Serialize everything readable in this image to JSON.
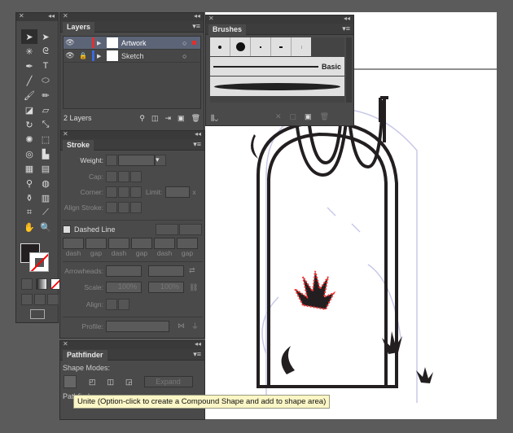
{
  "layers": {
    "tab": "Layers",
    "items": [
      {
        "name": "Artwork",
        "color": "#e03030",
        "selected": true
      },
      {
        "name": "Sketch",
        "color": "#3a6ae0",
        "locked": true
      }
    ],
    "count": "2 Layers"
  },
  "brushes": {
    "tab": "Brushes",
    "basic_label": "Basic"
  },
  "stroke": {
    "tab": "Stroke",
    "weight": "Weight:",
    "cap": "Cap:",
    "corner": "Corner:",
    "limit": "Limit:",
    "limit_unit": "x",
    "align_stroke": "Align Stroke:",
    "dashed_line": "Dashed Line",
    "dash_labels": [
      "dash",
      "gap",
      "dash",
      "gap",
      "dash",
      "gap"
    ],
    "arrowheads": "Arrowheads:",
    "scale": "Scale:",
    "scale_start": "100%",
    "scale_end": "100%",
    "align": "Align:",
    "profile": "Profile:"
  },
  "pathfinder": {
    "tab": "Pathfinder",
    "shape_modes": "Shape Modes:",
    "expand": "Expand",
    "pathfinders": "Pathfinders:"
  },
  "tooltip": "Unite (Option-click to create a Compound Shape and add to shape area)",
  "tools": [
    "selection",
    "direct-selection",
    "magic-wand",
    "lasso",
    "pen",
    "type",
    "line",
    "ellipse",
    "paintbrush",
    "pencil",
    "blob-brush",
    "eraser",
    "rotate",
    "scale",
    "warp",
    "free-transform",
    "shape-builder",
    "graph",
    "mesh",
    "gradient",
    "eyedropper",
    "blend",
    "symbol-sprayer",
    "column-graph",
    "artboard",
    "slice",
    "hand",
    "zoom"
  ],
  "colors": {
    "fill": "#231f20",
    "stroke": "none",
    "selection": "#ff3333",
    "sketch": "#c8c8e8"
  }
}
